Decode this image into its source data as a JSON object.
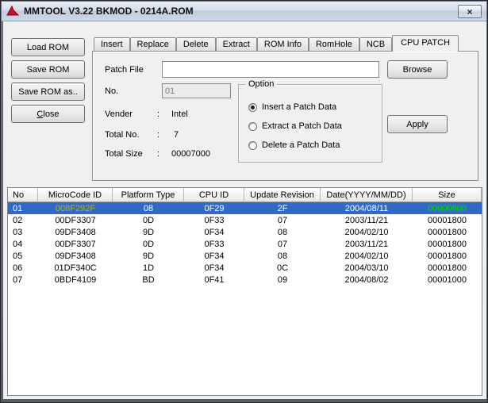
{
  "window": {
    "title": "MMTOOL V3.22 BKMOD - 0214A.ROM",
    "close_glyph": "×"
  },
  "left_buttons": {
    "load_rom": "Load ROM",
    "save_rom": "Save ROM",
    "save_rom_as": "Save ROM as..",
    "close_underline": "C",
    "close_rest": "lose"
  },
  "tabs": [
    {
      "label": "Insert"
    },
    {
      "label": "Replace"
    },
    {
      "label": "Delete"
    },
    {
      "label": "Extract"
    },
    {
      "label": "ROM Info"
    },
    {
      "label": "RomHole"
    },
    {
      "label": "NCB"
    },
    {
      "label": "CPU PATCH",
      "active": true
    }
  ],
  "patch_panel": {
    "patch_file_label": "Patch File",
    "patch_file_value": "",
    "browse_label": "Browse",
    "no_label": "No.",
    "no_value": "01",
    "vender_label": "Vender",
    "vender_colon": ":",
    "vender_value": "Intel",
    "total_no_label": "Total No.",
    "total_no_colon": ":",
    "total_no_value": "7",
    "total_size_label": "Total Size",
    "total_size_colon": ":",
    "total_size_value": "00007000",
    "option_title": "Option",
    "options": [
      {
        "label": "Insert a Patch Data",
        "selected": true
      },
      {
        "label": "Extract a Patch Data",
        "selected": false
      },
      {
        "label": "Delete a Patch Data",
        "selected": false
      }
    ],
    "apply_label": "Apply"
  },
  "table": {
    "columns": [
      "No",
      "MicroCode ID",
      "Platform Type",
      "CPU ID",
      "Update Revision",
      "Date(YYYY/MM/DD)",
      "Size"
    ],
    "rows": [
      [
        "01",
        "008F292F",
        "08",
        "0F29",
        "2F",
        "2004/08/11",
        "00000800"
      ],
      [
        "02",
        "00DF3307",
        "0D",
        "0F33",
        "07",
        "2003/11/21",
        "00001800"
      ],
      [
        "03",
        "09DF3408",
        "9D",
        "0F34",
        "08",
        "2004/02/10",
        "00001800"
      ],
      [
        "04",
        "00DF3307",
        "0D",
        "0F33",
        "07",
        "2003/11/21",
        "00001800"
      ],
      [
        "05",
        "09DF3408",
        "9D",
        "0F34",
        "08",
        "2004/02/10",
        "00001800"
      ],
      [
        "06",
        "01DF340C",
        "1D",
        "0F34",
        "0C",
        "2004/03/10",
        "00001800"
      ],
      [
        "07",
        "0BDF4109",
        "BD",
        "0F41",
        "09",
        "2004/08/02",
        "00001000"
      ]
    ],
    "selected_row_index": 0
  },
  "colors": {
    "selection_bg": "#316ac5",
    "selected_microcode_text": "#b6b600",
    "selected_size_text": "#00dc00",
    "logo_red": "#c8102e"
  }
}
